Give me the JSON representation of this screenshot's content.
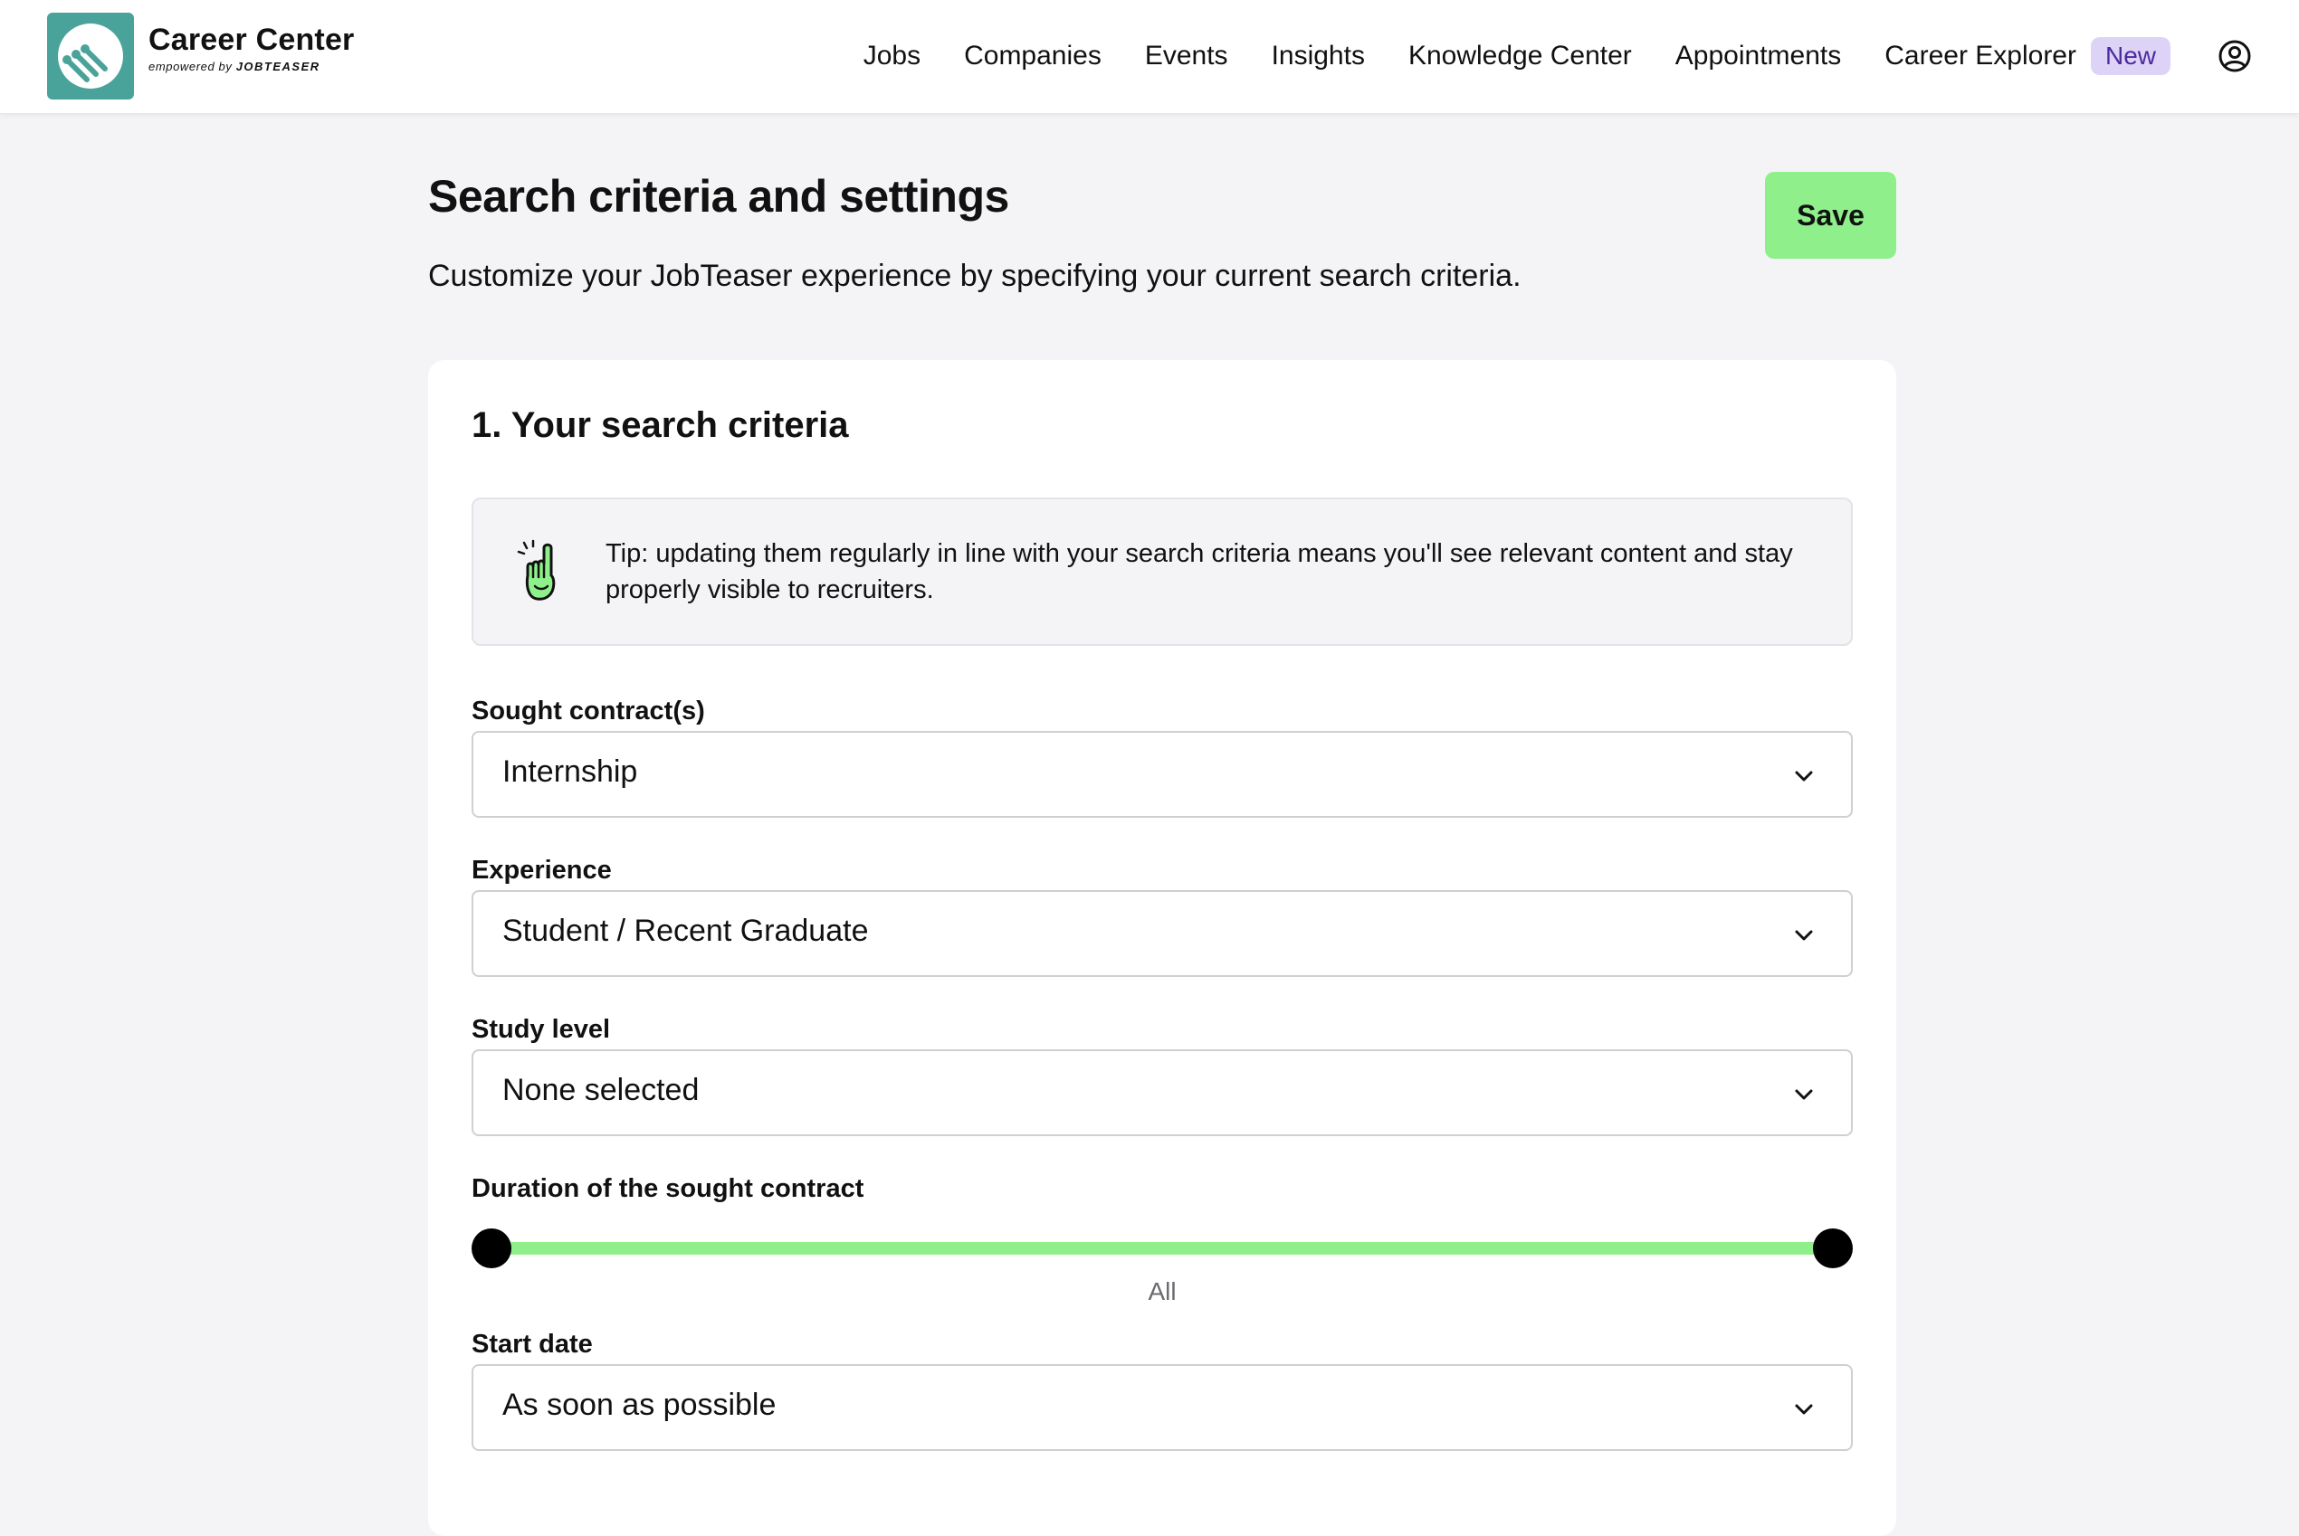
{
  "header": {
    "brand_title": "Career Center",
    "brand_sub_prefix": "empowered by",
    "brand_sub_name": "JOBTEASER",
    "nav": [
      {
        "label": "Jobs"
      },
      {
        "label": "Companies"
      },
      {
        "label": "Events"
      },
      {
        "label": "Insights"
      },
      {
        "label": "Knowledge Center"
      },
      {
        "label": "Appointments"
      },
      {
        "label": "Career Explorer"
      }
    ],
    "new_badge": "New",
    "user_icon": "user-circle-icon"
  },
  "page": {
    "title": "Search criteria and settings",
    "description": "Customize your JobTeaser experience by specifying your current search criteria.",
    "save_label": "Save"
  },
  "section": {
    "title": "1. Your search criteria",
    "tip_icon": "pointing-hand-icon",
    "tip": "Tip: updating them regularly in line with your search criteria means you'll see relevant content and stay properly visible to recruiters."
  },
  "fields": {
    "contract": {
      "label": "Sought contract(s)",
      "value": "Internship"
    },
    "experience": {
      "label": "Experience",
      "value": "Student / Recent Graduate"
    },
    "study_level": {
      "label": "Study level",
      "value": "None selected"
    },
    "duration": {
      "label": "Duration of the sought contract",
      "caption": "All",
      "range_min_fraction": 0,
      "range_max_fraction": 1
    },
    "start_date": {
      "label": "Start date",
      "value": "As soon as possible"
    }
  },
  "colors": {
    "accent_green": "#8ff08b",
    "logo_teal": "#4aa39a",
    "badge_purple_bg": "#ddd3f6",
    "badge_purple_text": "#4b2a9e",
    "page_bg": "#f4f4f6"
  }
}
